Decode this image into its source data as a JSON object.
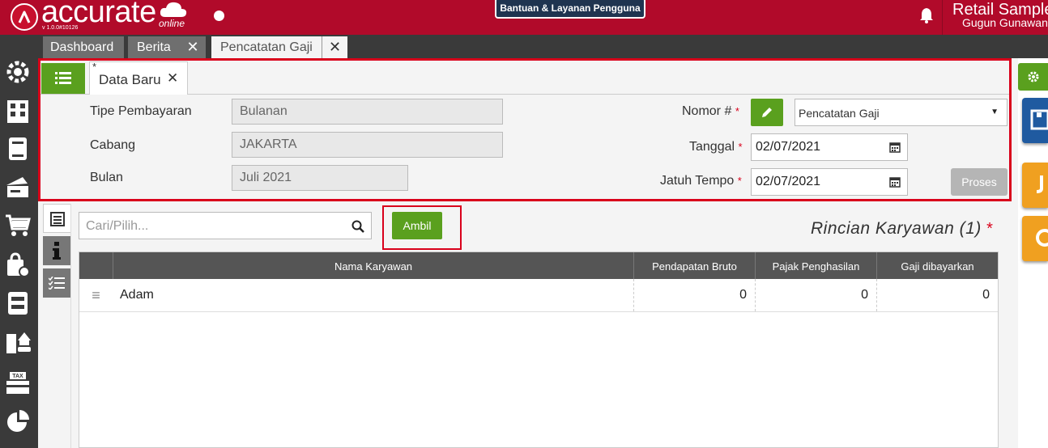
{
  "app": {
    "logo_text": "accurate",
    "logo_sub": "online",
    "version": "v 1.0.0#10126",
    "help_label": "Bantuan & Layanan Pengguna",
    "company": "Retail Sample",
    "user": "Gugun Gunawan"
  },
  "tabs": [
    {
      "label": "Dashboard",
      "active": false
    },
    {
      "label": "Berita",
      "active": false
    },
    {
      "label": "Pencatatan Gaji",
      "active": true
    }
  ],
  "sidebar": {
    "icons": [
      "settings-icon",
      "building-icon",
      "ledger-icon",
      "cash-icon",
      "cart-icon",
      "bag-icon",
      "archive-icon",
      "assets-icon",
      "tax-icon",
      "chart-icon"
    ]
  },
  "form": {
    "subtab_marker": "*",
    "subtab_label": "Data Baru",
    "tipe_label": "Tipe Pembayaran",
    "tipe_value": "Bulanan",
    "cabang_label": "Cabang",
    "cabang_value": "JAKARTA",
    "bulan_label": "Bulan",
    "bulan_value": "Juli 2021",
    "nomor_label": "Nomor #",
    "nomor_value": "Pencatatan Gaji",
    "tanggal_label": "Tanggal",
    "tanggal_value": "02/07/2021",
    "jatuh_tempo_label": "Jatuh Tempo",
    "jatuh_tempo_value": "02/07/2021",
    "proses_label": "Proses",
    "required_mark": "*"
  },
  "detail": {
    "search_placeholder": "Cari/Pilih...",
    "ambil_label": "Ambil",
    "title": "Rincian Karyawan (1)",
    "columns": [
      "Nama Karyawan",
      "Pendapatan Bruto",
      "Pajak Penghasilan",
      "Gaji dibayarkan"
    ],
    "rows": [
      {
        "handle": "≡",
        "nama": "Adam",
        "bruto": "0",
        "pajak": "0",
        "gaji": "0"
      }
    ]
  },
  "colors": {
    "brand_red": "#b10a2a",
    "accent_green": "#5aa01e",
    "highlight_red": "#d9001b",
    "orange": "#f0a020",
    "blue": "#1f5aa0"
  }
}
